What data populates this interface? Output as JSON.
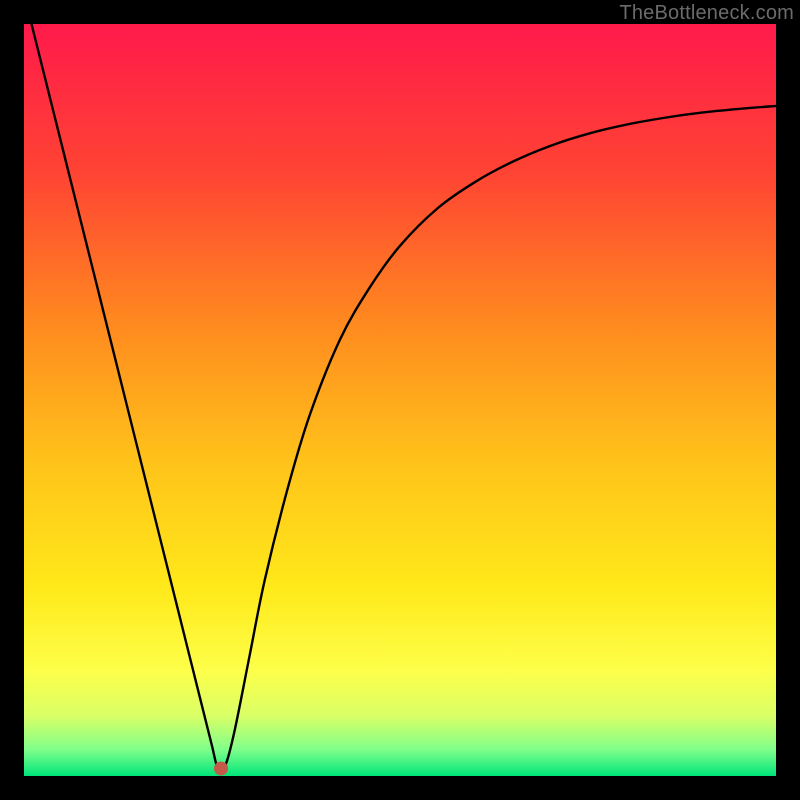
{
  "watermark": "TheBottleneck.com",
  "chart_data": {
    "type": "line",
    "title": "",
    "xlabel": "",
    "ylabel": "",
    "xlim": [
      0,
      100
    ],
    "ylim": [
      0,
      100
    ],
    "grid": false,
    "legend": false,
    "background_gradient_stops": [
      {
        "offset": 0.0,
        "color": "#ff1a4b"
      },
      {
        "offset": 0.2,
        "color": "#ff4433"
      },
      {
        "offset": 0.4,
        "color": "#ff8a1f"
      },
      {
        "offset": 0.58,
        "color": "#ffc21a"
      },
      {
        "offset": 0.75,
        "color": "#ffe91a"
      },
      {
        "offset": 0.86,
        "color": "#fdff4a"
      },
      {
        "offset": 0.92,
        "color": "#d9ff66"
      },
      {
        "offset": 0.965,
        "color": "#7fff8a"
      },
      {
        "offset": 1.0,
        "color": "#00e57a"
      }
    ],
    "series": [
      {
        "name": "bottleneck-curve",
        "color": "#000000",
        "width": 2.4,
        "x": [
          1,
          3,
          5,
          7,
          9,
          11,
          13,
          15,
          17,
          19,
          21,
          22.5,
          24,
          25,
          25.8,
          26.8,
          28,
          30,
          32,
          35,
          38,
          42,
          46,
          50,
          55,
          60,
          65,
          70,
          75,
          80,
          85,
          90,
          95,
          100
        ],
        "y": [
          100,
          92,
          84,
          76,
          68,
          60,
          52,
          44,
          36,
          28,
          20,
          14,
          8,
          4,
          1,
          1.5,
          6,
          16,
          26,
          38,
          48,
          58,
          65,
          70.5,
          75.5,
          79,
          81.7,
          83.8,
          85.4,
          86.6,
          87.5,
          88.2,
          88.7,
          89.1
        ]
      }
    ],
    "marker": {
      "name": "optimal-point",
      "x": 26.2,
      "y": 1.0,
      "r": 7,
      "color": "#c45a4a"
    }
  }
}
